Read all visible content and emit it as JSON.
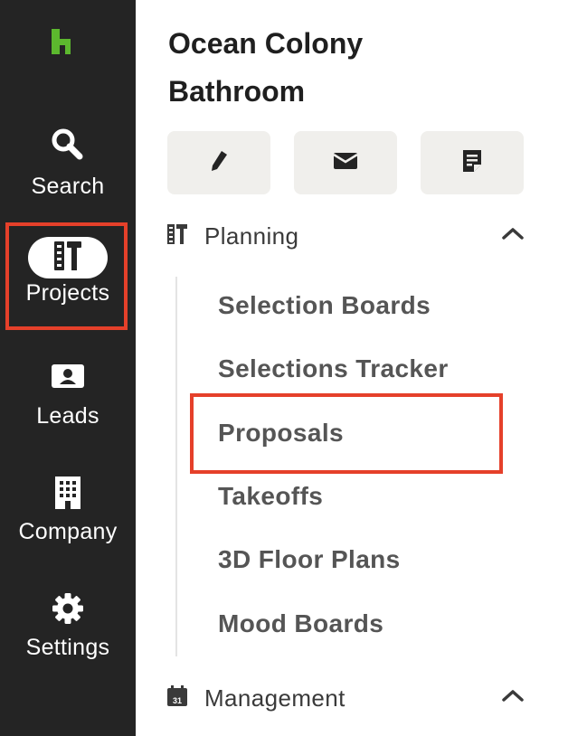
{
  "app": {
    "brand_color": "#5cb82e",
    "logo_icon": "houzz-logo-icon"
  },
  "nav": {
    "items": [
      {
        "label": "Search",
        "icon": "search-icon"
      },
      {
        "label": "Projects",
        "icon": "projects-icon"
      },
      {
        "label": "Leads",
        "icon": "id-card-icon"
      },
      {
        "label": "Company",
        "icon": "building-icon"
      },
      {
        "label": "Settings",
        "icon": "gear-icon"
      }
    ],
    "active": "Projects"
  },
  "project": {
    "title_line1": "Ocean Colony",
    "title_line2": "Bathroom",
    "actions": [
      {
        "icon": "pencil-icon"
      },
      {
        "icon": "envelope-icon"
      },
      {
        "icon": "note-icon"
      }
    ]
  },
  "sections": {
    "planning": {
      "label": "Planning",
      "icon": "projects-icon",
      "expanded": true,
      "items": [
        "Selection Boards",
        "Selections Tracker",
        "Proposals",
        "Takeoffs",
        "3D Floor Plans",
        "Mood Boards"
      ]
    },
    "management": {
      "label": "Management",
      "icon": "calendar-icon",
      "calendar_day": "31",
      "expanded": true
    }
  },
  "highlight_color": "#e5402a"
}
